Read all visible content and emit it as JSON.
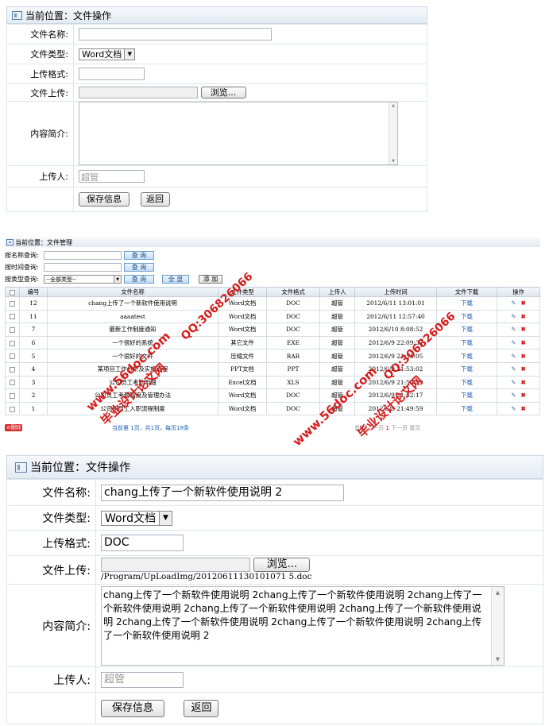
{
  "panel1": {
    "breadcrumb": "当前位置：文件操作",
    "labels": {
      "name": "文件名称:",
      "type": "文件类型:",
      "format": "上传格式:",
      "upload": "文件上传:",
      "intro": "内容简介:",
      "uploader": "上传人:"
    },
    "values": {
      "name": "",
      "type": "Word文档",
      "format": "",
      "intro": "",
      "uploader": "超管"
    },
    "browse_label": "浏览...",
    "save_label": "保存信息",
    "back_label": "返回"
  },
  "panel2": {
    "breadcrumb": "当前位置：文件管理",
    "query": {
      "by_name": "按名称查询:",
      "by_time": "按时间查询:",
      "by_type": "按类型查询:",
      "type_default": "--全部类型--",
      "search": "查 询",
      "show_all": "全 显",
      "add": "添 加"
    },
    "columns": [
      "编号",
      "文件名称",
      "文件类型",
      "文件格式",
      "上传人",
      "上传时间",
      "文件下载",
      "操作"
    ],
    "rows": [
      {
        "id": "12",
        "name": "chang上传了一个新软件使用说明",
        "type": "Word文档",
        "format": "DOC",
        "uploader": "超管",
        "time": "2012/6/11 13:01:01",
        "download": "下载"
      },
      {
        "id": "11",
        "name": "aaaatest",
        "type": "Word文档",
        "format": "DOC",
        "uploader": "超管",
        "time": "2012/6/11 12:57:40",
        "download": "下载"
      },
      {
        "id": "7",
        "name": "最新工作制度通知",
        "type": "Word文档",
        "format": "DOC",
        "uploader": "超管",
        "time": "2012/6/10 8:08:52",
        "download": "下载"
      },
      {
        "id": "6",
        "name": "一个很好的系统",
        "type": "其它文件",
        "format": "EXE",
        "uploader": "超管",
        "time": "2012/6/9 22:09:32",
        "download": "下载"
      },
      {
        "id": "5",
        "name": "一个很好的文件",
        "type": "压缩文件",
        "format": "RAR",
        "uploader": "超管",
        "time": "2012/6/9 21:54:05",
        "download": "下载"
      },
      {
        "id": "4",
        "name": "某项目工作分析及实施流程",
        "type": "PPT文档",
        "format": "PPT",
        "uploader": "超管",
        "time": "2012/6/9 21:53:02",
        "download": "下载"
      },
      {
        "id": "3",
        "name": "公司员工考勤明细",
        "type": "Excel文档",
        "format": "XLS",
        "uploader": "超管",
        "time": "2012/6/9 21:52:59",
        "download": "下载"
      },
      {
        "id": "2",
        "name": "公司员工考勤制度及管理办法",
        "type": "Word文档",
        "format": "DOC",
        "uploader": "超管",
        "time": "2012/6/9 21:52:17",
        "download": "下载"
      },
      {
        "id": "1",
        "name": "公司新员工入职流程制度",
        "type": "Word文档",
        "format": "DOC",
        "uploader": "超管",
        "time": "2012/6/9 21:49:59",
        "download": "下载"
      }
    ],
    "delete_label": "删除",
    "pager_info": "当前第 1页，共1页，每页18条",
    "pager": {
      "first": "首页",
      "prev": "上一页",
      "current": "1",
      "next": "下一页",
      "last": "尾页"
    }
  },
  "watermarks": {
    "site": "www.56doc.com",
    "brand": "毕业设计论文网",
    "qq": "QQ:306826066"
  },
  "panel3": {
    "breadcrumb": "当前位置：文件操作",
    "labels": {
      "name": "文件名称:",
      "type": "文件类型:",
      "format": "上传格式:",
      "upload": "文件上传:",
      "intro": "内容简介:",
      "uploader": "上传人:"
    },
    "values": {
      "name": "chang上传了一个新软件使用说明 2",
      "type": "Word文档",
      "format": "DOC",
      "upload_path": "/Program/UpLoadImg/20120611130101071 5.doc",
      "intro": "chang上传了一个新软件使用说明 2chang上传了一个新软件使用说明 2chang上传了一个新软件使用说明 2chang上传了一个新软件使用说明 2chang上传了一个新软件使用说明 2chang上传了一个新软件使用说明 2chang上传了一个新软件使用说明 2chang上传了一个新软件使用说明 2",
      "uploader": "超管"
    },
    "browse_label": "浏览...",
    "save_label": "保存信息",
    "back_label": "返回"
  },
  "colors": {
    "title_gradient_top": "#f6f8fb",
    "title_gradient_bottom": "#e4ebf3",
    "link_blue": "#1f5fb3",
    "delete_red": "#d62a2a",
    "watermark_red": "#d61c1c"
  }
}
